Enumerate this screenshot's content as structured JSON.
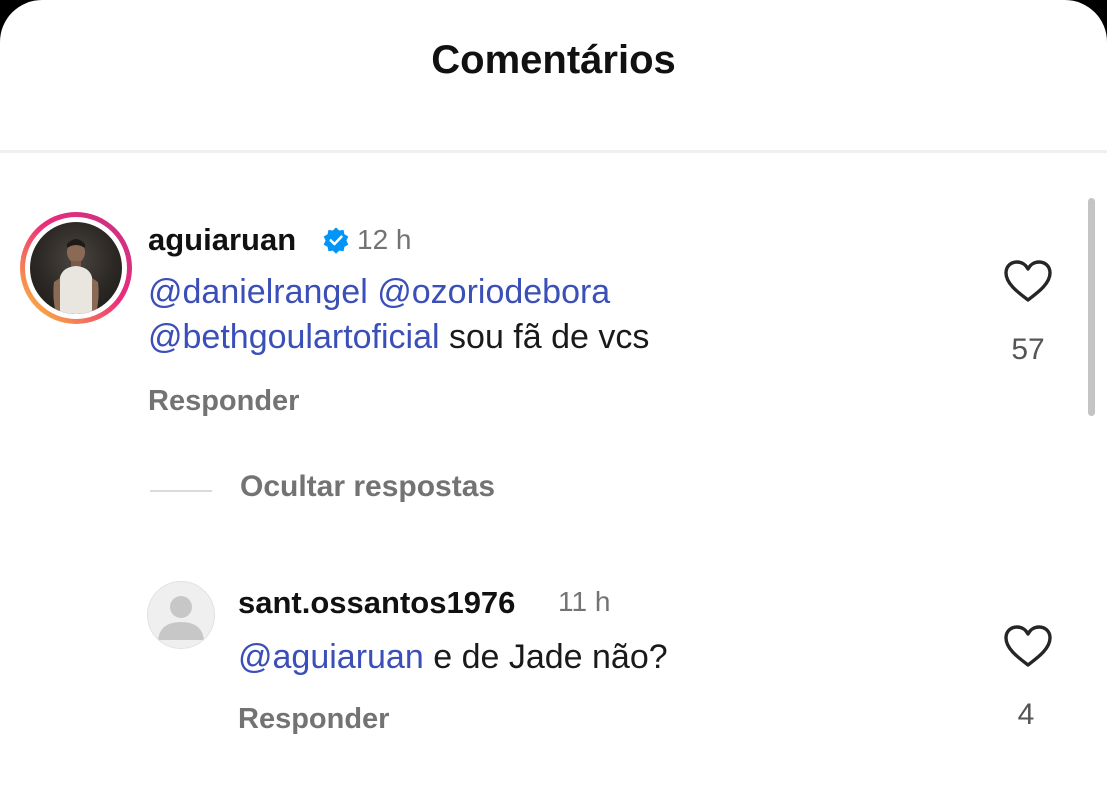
{
  "header": {
    "title": "Comentários"
  },
  "comments": [
    {
      "username": "aguiaruan",
      "verified": true,
      "time": "12 h",
      "line1": {
        "mention1": "@danielrangel",
        "mention2": "@ozoriodebora"
      },
      "line2": {
        "mention": "@bethgoulartoficial",
        "text": "sou fã de vcs"
      },
      "reply_label": "Responder",
      "likes": "57",
      "avatar_icon": "profile-photo",
      "like_icon": "heart-outline-icon"
    }
  ],
  "hide_replies": {
    "label": "Ocultar respostas"
  },
  "replies": [
    {
      "username": "sant.ossantos1976",
      "time": "11 h",
      "mention": "@aguiaruan",
      "text": "e de Jade não?",
      "reply_label": "Responder",
      "likes": "4",
      "avatar_icon": "default-avatar-icon",
      "like_icon": "heart-outline-icon"
    }
  ],
  "colors": {
    "mention": "#3b4fb8",
    "secondary_text": "#737373",
    "verified": "#0095f6"
  }
}
